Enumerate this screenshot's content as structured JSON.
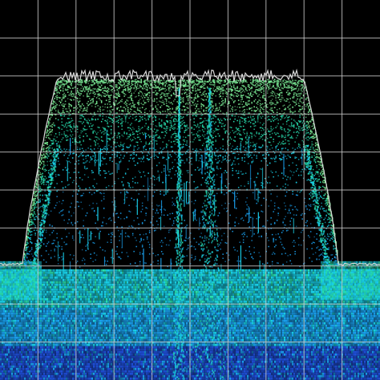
{
  "display": {
    "background_color": "#000000",
    "grid_color": "#c8c8c8",
    "grid_columns": 10,
    "grid_rows": 10,
    "trace_color": "#d8d8d8",
    "density_palette": [
      "#1b2a8a",
      "#1f4fd8",
      "#1aa0ee",
      "#19d0e8",
      "#28e0b0",
      "#7ef29a"
    ]
  },
  "signal": {
    "description_type": "wideband-carrier-with-center-pilot",
    "noise_floor_level": 0.3,
    "carrier_top_level": 0.79,
    "carrier_start_fraction": 0.15,
    "carrier_end_fraction": 0.8,
    "center_pilot_fraction": 0.47
  }
}
